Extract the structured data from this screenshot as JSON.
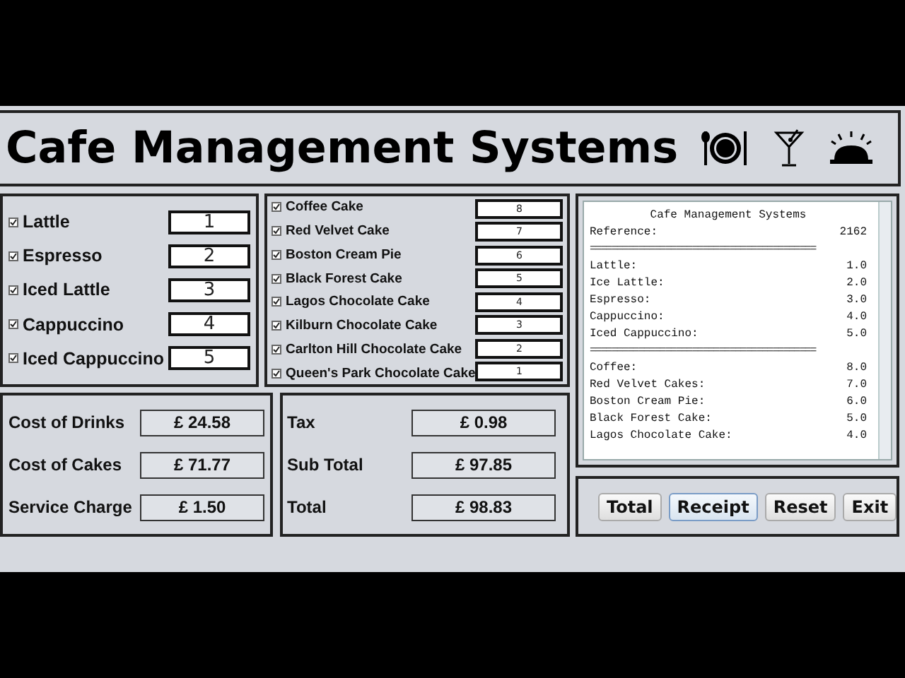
{
  "header": {
    "title": "Cafe Management Systems"
  },
  "drinks": [
    {
      "name": "Lattle",
      "checked": true,
      "quantity": "1"
    },
    {
      "name": "Espresso",
      "checked": true,
      "quantity": "2"
    },
    {
      "name": "Iced Lattle",
      "checked": true,
      "quantity": "3"
    },
    {
      "name": "Cappuccino",
      "checked": true,
      "quantity": "4"
    },
    {
      "name": "Iced Cappuccino",
      "checked": true,
      "quantity": "5"
    }
  ],
  "cakes": [
    {
      "name": "Coffee Cake",
      "checked": true
    },
    {
      "name": "Red Velvet Cake",
      "checked": true
    },
    {
      "name": "Boston Cream Pie",
      "checked": true
    },
    {
      "name": "Black Forest Cake",
      "checked": true
    },
    {
      "name": "Lagos Chocolate Cake",
      "checked": true
    },
    {
      "name": "Kilburn Chocolate Cake",
      "checked": true
    },
    {
      "name": "Carlton Hill Chocolate Cake",
      "checked": true
    },
    {
      "name": "Queen's Park Chocolate Cake",
      "checked": true
    }
  ],
  "cake_quantities": [
    "8",
    "7",
    "6",
    "5",
    "4",
    "3",
    "2",
    "1"
  ],
  "receipt": [
    {
      "kind": "title",
      "text": "Cafe Management Systems"
    },
    {
      "kind": "row",
      "label": "Reference:",
      "value": "2162"
    },
    {
      "kind": "rule",
      "text": "=========================================="
    },
    {
      "kind": "row",
      "label": "Lattle:",
      "value": "1.0"
    },
    {
      "kind": "row",
      "label": "Ice Lattle:",
      "value": "2.0"
    },
    {
      "kind": "row",
      "label": "Espresso:",
      "value": "3.0"
    },
    {
      "kind": "row",
      "label": "Cappuccino:",
      "value": "4.0"
    },
    {
      "kind": "row",
      "label": "Iced Cappuccino:",
      "value": "5.0"
    },
    {
      "kind": "rule",
      "text": "=========================================="
    },
    {
      "kind": "row",
      "label": "Coffee:",
      "value": "8.0"
    },
    {
      "kind": "row",
      "label": "Red Velvet Cakes:",
      "value": "7.0"
    },
    {
      "kind": "row",
      "label": "Boston Cream Pie:",
      "value": "6.0"
    },
    {
      "kind": "row",
      "label": "Black Forest Cake:",
      "value": "5.0"
    },
    {
      "kind": "row",
      "label": "Lagos Chocolate Cake:",
      "value": "4.0"
    }
  ],
  "costs": [
    {
      "label": "Cost of Drinks",
      "value": "£ 24.58"
    },
    {
      "label": "Cost of Cakes",
      "value": "£ 71.77"
    },
    {
      "label": "Service Charge",
      "value": "£ 1.50"
    }
  ],
  "totals": [
    {
      "label": "Tax",
      "value": "£ 0.98"
    },
    {
      "label": "Sub Total",
      "value": "£ 97.85"
    },
    {
      "label": "Total",
      "value": "£ 98.83"
    }
  ],
  "buttons": [
    {
      "label": "Total",
      "selected": false
    },
    {
      "label": "Receipt",
      "selected": true
    },
    {
      "label": "Reset",
      "selected": false
    },
    {
      "label": "Exit",
      "selected": false
    }
  ]
}
